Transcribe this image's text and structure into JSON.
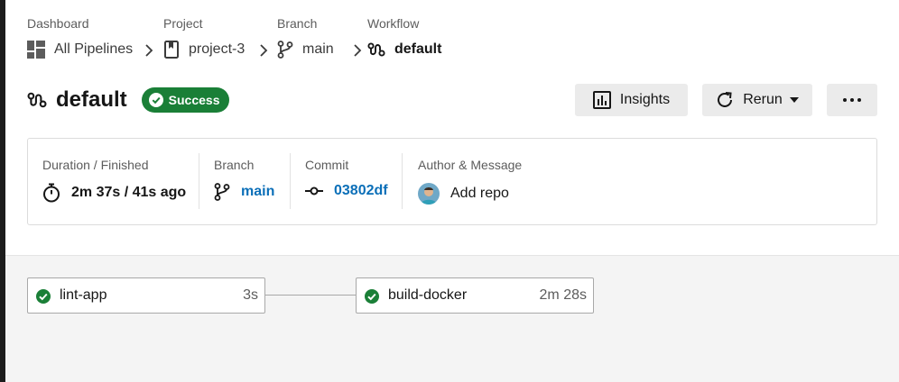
{
  "breadcrumb": {
    "dashboard": {
      "caption": "Dashboard",
      "value": "All Pipelines",
      "icon": "dashboard-grid-icon"
    },
    "project": {
      "caption": "Project",
      "value": "project-3",
      "icon": "bookmark-icon"
    },
    "branch": {
      "caption": "Branch",
      "value": "main",
      "icon": "git-branch-icon"
    },
    "workflow": {
      "caption": "Workflow",
      "value": "default",
      "icon": "workflow-icon"
    },
    "separator_icon": "chevron-right-icon"
  },
  "header": {
    "title": "default",
    "status": "Success",
    "status_color": "#1a7f37"
  },
  "actions": {
    "insights_label": "Insights",
    "rerun_label": "Rerun",
    "more_icon": "more-horizontal-icon"
  },
  "summary": {
    "duration": {
      "caption": "Duration / Finished",
      "value": "2m 37s / 41s ago",
      "icon": "stopwatch-icon"
    },
    "branch": {
      "caption": "Branch",
      "value": "main",
      "icon": "git-branch-icon"
    },
    "commit": {
      "caption": "Commit",
      "value": "03802df",
      "icon": "git-commit-icon"
    },
    "author": {
      "caption": "Author & Message",
      "message": "Add repo",
      "icon": "avatar"
    }
  },
  "jobs": [
    {
      "name": "lint-app",
      "duration": "3s",
      "status": "success"
    },
    {
      "name": "build-docker",
      "duration": "2m 28s",
      "status": "success"
    }
  ],
  "colors": {
    "link": "#0b6fb8",
    "success": "#1a7f37",
    "graph_bg": "#f4f4f4"
  }
}
